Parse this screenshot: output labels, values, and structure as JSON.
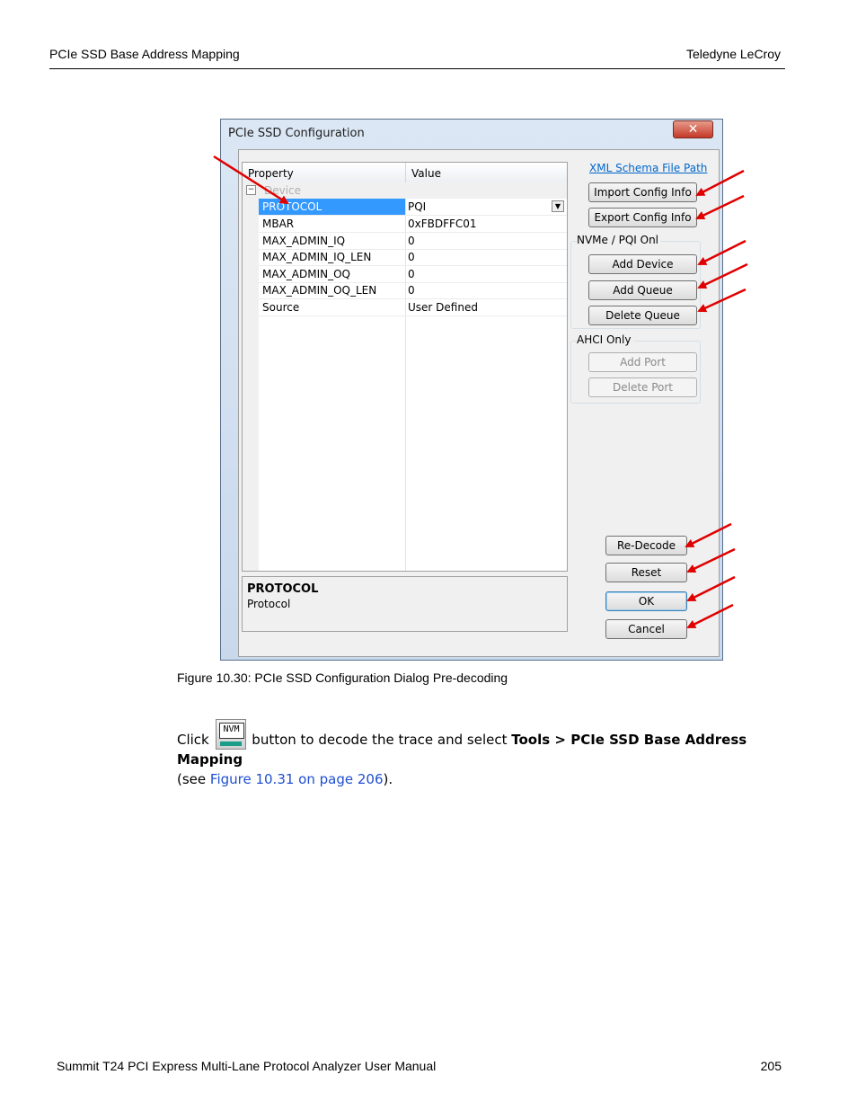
{
  "header": {
    "left": "PCIe SSD Base Address Mapping",
    "right": "Teledyne LeCroy"
  },
  "footer": {
    "left": "Summit T24 PCI Express Multi-Lane Protocol Analyzer User Manual",
    "right": "205"
  },
  "dialog": {
    "title": "PCIe SSD Configuration",
    "close_glyph": "✕",
    "grid": {
      "col_property": "Property",
      "col_value": "Value",
      "category": "Device",
      "category_toggle": "−",
      "rows": [
        {
          "name": "PROTOCOL",
          "value": "PQI",
          "selected": true
        },
        {
          "name": "MBAR",
          "value": "0xFBDFFC01"
        },
        {
          "name": "MAX_ADMIN_IQ",
          "value": "0"
        },
        {
          "name": "MAX_ADMIN_IQ_LEN",
          "value": "0"
        },
        {
          "name": "MAX_ADMIN_OQ",
          "value": "0"
        },
        {
          "name": "MAX_ADMIN_OQ_LEN",
          "value": "0"
        },
        {
          "name": "Source",
          "value": "User Defined"
        }
      ],
      "dropdown_glyph": "▼"
    },
    "description": {
      "title": "PROTOCOL",
      "text": "Protocol"
    },
    "xml_link": "XML Schema File Path",
    "buttons": {
      "import": "Import Config Info",
      "export": "Export Config Info",
      "add_device": "Add Device",
      "add_queue": "Add Queue",
      "delete_queue": "Delete Queue",
      "add_port": "Add Port",
      "delete_port": "Delete Port",
      "redecode": "Re-Decode",
      "reset": "Reset",
      "ok": "OK",
      "cancel": "Cancel"
    },
    "groups": {
      "nvme": "NVMe / PQI Onl",
      "ahci": "AHCI Only"
    }
  },
  "caption": "Figure 10.30:  PCIe SSD Configuration Dialog Pre-decoding",
  "paragraph": {
    "click": "Click",
    "icon_label": "NVM",
    "after_icon": " button to decode the trace and select ",
    "bold": "Tools > PCIe SSD Base Address Mapping",
    "see_open": "(see ",
    "link": "Figure 10.31 on page 206",
    "see_close": ")."
  },
  "colors": {
    "arrow": "#e00000",
    "selection": "#3399ff",
    "link": "#0066cc"
  }
}
